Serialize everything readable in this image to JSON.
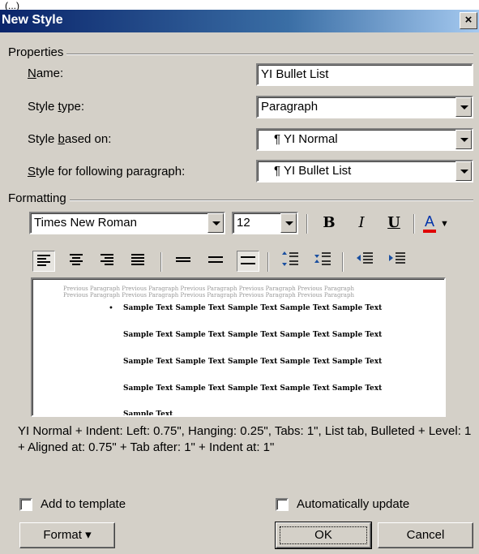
{
  "window": {
    "title_stub": "(...)",
    "title": "New Style",
    "close_glyph": "×"
  },
  "properties": {
    "group_label": "Properties",
    "name_label": "Name:",
    "name_value": "YI Bullet List",
    "style_type_label": "Style type:",
    "style_type_value": "Paragraph",
    "based_on_label": "Style based on:",
    "based_on_value": "¶ YI Normal",
    "following_label": "Style for following paragraph:",
    "following_value": "¶ YI Bullet List"
  },
  "formatting": {
    "group_label": "Formatting",
    "font_value": "Times New Roman",
    "size_value": "12",
    "bold": "B",
    "italic": "I",
    "underline": "U",
    "font_color": "A",
    "font_color_hex": "#e00000"
  },
  "preview": {
    "previous_line": "Previous Paragraph Previous Paragraph Previous Paragraph Previous Paragraph Previous Paragraph",
    "sample_line": "Sample Text Sample Text Sample Text Sample Text Sample Text",
    "sample_last": "Sample Text",
    "bullet": "•"
  },
  "description": "YI Normal + Indent: Left:  0.75\", Hanging:  0.25\", Tabs:  1\", List tab, Bulleted + Level: 1 + Aligned at:  0.75\" + Tab after:  1\" + Indent at: 1\"",
  "options": {
    "add_to_template": "Add to template",
    "auto_update": "Automatically update"
  },
  "buttons": {
    "format": "Format",
    "format_arrow": "▾",
    "ok": "OK",
    "cancel": "Cancel"
  }
}
